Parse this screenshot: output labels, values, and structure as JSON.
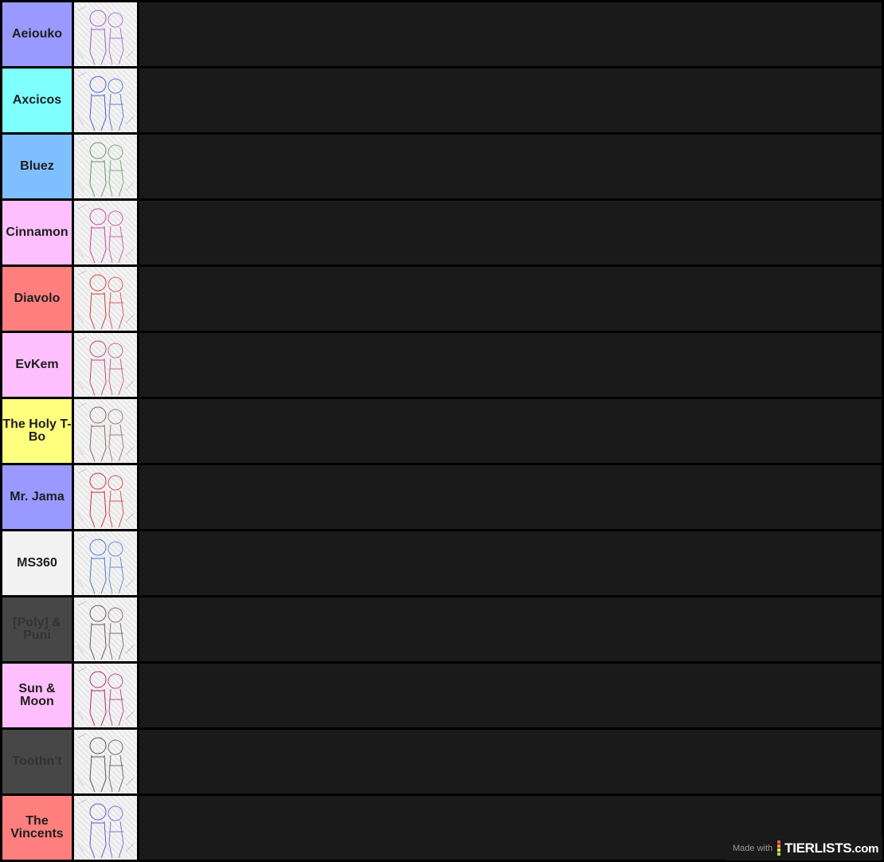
{
  "tiers": [
    {
      "label": "Aeiouko",
      "color": "#9999ff",
      "item": "character-sketch-purple",
      "stroke": "#9a5fd0"
    },
    {
      "label": "Axcicos",
      "color": "#7ffffe",
      "item": "character-sketch-blue",
      "stroke": "#4a5fd0"
    },
    {
      "label": "Bluez",
      "color": "#80bfff",
      "item": "character-sketch-green",
      "stroke": "#5f9a6a"
    },
    {
      "label": "Cinnamon",
      "color": "#ffbfff",
      "item": "character-sketch-magenta",
      "stroke": "#d03fa0"
    },
    {
      "label": "Diavolo",
      "color": "#ff7f7f",
      "item": "character-sketch-red",
      "stroke": "#d04040"
    },
    {
      "label": "EvKem",
      "color": "#ffbfff",
      "item": "character-sketch-rose",
      "stroke": "#c04a7a"
    },
    {
      "label": "The Holy T-Bo",
      "color": "#ffff7f",
      "item": "character-sketch-brown",
      "stroke": "#8a6a6a"
    },
    {
      "label": "Mr. Jama",
      "color": "#9999ff",
      "item": "character-sketch-crimson",
      "stroke": "#d03040"
    },
    {
      "label": "MS360",
      "color": "#f2f2f2",
      "item": "character-sketch-lightblue",
      "stroke": "#4a7ad0"
    },
    {
      "label": "[Poly] & Puni",
      "color": "#474747",
      "item": "character-sketch-grey",
      "stroke": "#6a5a5a",
      "dark": true
    },
    {
      "label": "Sun & Moon",
      "color": "#ffbfff",
      "item": "character-sketch-pink",
      "stroke": "#b02a70"
    },
    {
      "label": "Toothn't",
      "color": "#474747",
      "item": "character-sketch-black",
      "stroke": "#555555",
      "dark": true
    },
    {
      "label": "The Vincents",
      "color": "#ff7f7f",
      "item": "character-sketch-violet",
      "stroke": "#6a5ad0"
    }
  ],
  "watermark": {
    "made_with": "Made with",
    "brand": "TIERLISTS",
    "brand_suffix": ".com",
    "bar_colors": [
      "#ff5a5a",
      "#ffa040",
      "#ffe040",
      "#a0e040"
    ]
  }
}
